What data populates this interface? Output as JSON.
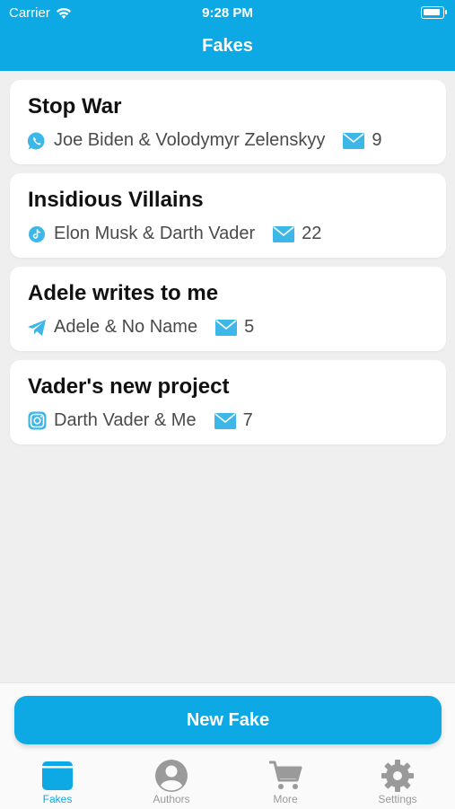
{
  "status_bar": {
    "carrier": "Carrier",
    "time": "9:28 PM"
  },
  "nav": {
    "title": "Fakes"
  },
  "fakes": [
    {
      "title": "Stop War",
      "app_icon": "whatsapp-icon",
      "participants": "Joe Biden & Volodymyr Zelenskyy",
      "count": "9"
    },
    {
      "title": "Insidious Villains",
      "app_icon": "tiktok-icon",
      "participants": "Elon Musk & Darth Vader",
      "count": "22"
    },
    {
      "title": "Adele writes to me",
      "app_icon": "telegram-icon",
      "participants": "Adele & No Name",
      "count": "5"
    },
    {
      "title": "Vader's new project",
      "app_icon": "instagram-icon",
      "participants": "Darth Vader & Me",
      "count": "7"
    }
  ],
  "actions": {
    "new_fake": "New Fake"
  },
  "tabs": [
    {
      "label": "Fakes",
      "icon": "fakes-icon",
      "active": true
    },
    {
      "label": "Authors",
      "icon": "person-icon",
      "active": false
    },
    {
      "label": "More",
      "icon": "cart-icon",
      "active": false
    },
    {
      "label": "Settings",
      "icon": "gear-icon",
      "active": false
    }
  ],
  "colors": {
    "accent": "#0ca9e4",
    "background": "#efefef",
    "icon_blue": "#3db7e8"
  }
}
